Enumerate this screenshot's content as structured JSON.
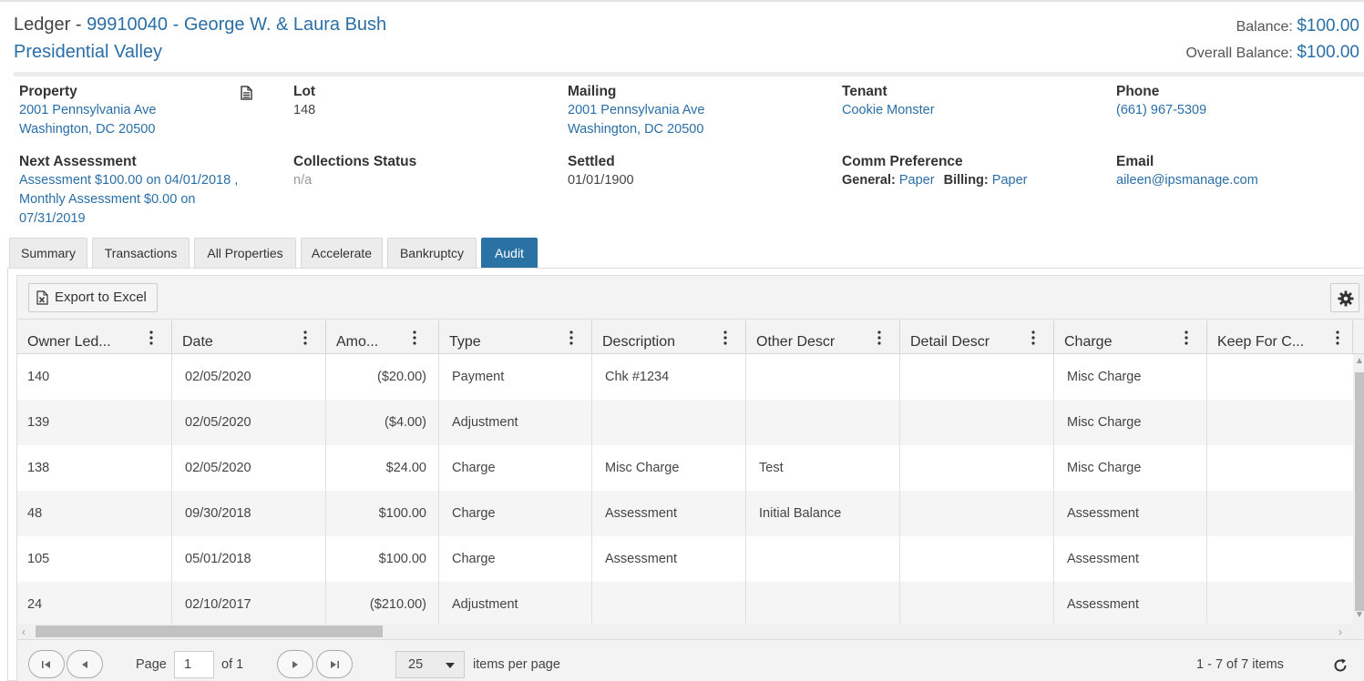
{
  "header": {
    "prefix": "Ledger - ",
    "account": "99910040 - George W. & Laura Bush",
    "community": "Presidential Valley",
    "balance_label": "Balance: ",
    "balance": "$100.00",
    "overall_label": "Overall Balance: ",
    "overall": "$100.00"
  },
  "info": {
    "property": {
      "label": "Property",
      "line1": "2001 Pennsylvania Ave",
      "line2": "Washington, DC 20500"
    },
    "lot": {
      "label": "Lot",
      "value": "148"
    },
    "mailing": {
      "label": "Mailing",
      "line1": "2001 Pennsylvania Ave",
      "line2": "Washington, DC 20500"
    },
    "tenant": {
      "label": "Tenant",
      "value": "Cookie Monster"
    },
    "phone": {
      "label": "Phone",
      "value": "(661) 967-5309"
    },
    "next_assessment": {
      "label": "Next Assessment",
      "line1": "Assessment $100.00 on 04/01/2018 ,",
      "line2": "Monthly Assessment $0.00 on",
      "line3": "07/31/2019"
    },
    "collections": {
      "label": "Collections Status",
      "value": "n/a"
    },
    "settled": {
      "label": "Settled",
      "value": "01/01/1900"
    },
    "comm": {
      "label": "Comm Preference",
      "general_label": "General:",
      "general": "Paper",
      "billing_label": "Billing:",
      "billing": "Paper"
    },
    "email": {
      "label": "Email",
      "value": "aileen@ipsmanage.com"
    }
  },
  "tabs": [
    "Summary",
    "Transactions",
    "All Properties",
    "Accelerate",
    "Bankruptcy",
    "Audit"
  ],
  "active_tab": "Audit",
  "toolbar": {
    "export_label": "Export to Excel"
  },
  "columns": [
    "Owner Led...",
    "Date",
    "Amo...",
    "Type",
    "Description",
    "Other Descr",
    "Detail Descr",
    "Charge",
    "Keep For C..."
  ],
  "rows": [
    [
      "140",
      "02/05/2020",
      "($20.00)",
      "Payment",
      "Chk #1234",
      "",
      "",
      "Misc Charge",
      ""
    ],
    [
      "139",
      "02/05/2020",
      "($4.00)",
      "Adjustment",
      "",
      "",
      "",
      "Misc Charge",
      ""
    ],
    [
      "138",
      "02/05/2020",
      "$24.00",
      "Charge",
      "Misc Charge",
      "Test",
      "",
      "Misc Charge",
      ""
    ],
    [
      "48",
      "09/30/2018",
      "$100.00",
      "Charge",
      "Assessment",
      "Initial Balance",
      "",
      "Assessment",
      ""
    ],
    [
      "105",
      "05/01/2018",
      "$100.00",
      "Charge",
      "Assessment",
      "",
      "",
      "Assessment",
      ""
    ],
    [
      "24",
      "02/10/2017",
      "($210.00)",
      "Adjustment",
      "",
      "",
      "",
      "Assessment",
      ""
    ]
  ],
  "pager": {
    "page_label": "Page",
    "page": "1",
    "of_label": "of 1",
    "page_size": "25",
    "per_page_label": "items per page",
    "summary": "1 - 7 of 7 items"
  }
}
